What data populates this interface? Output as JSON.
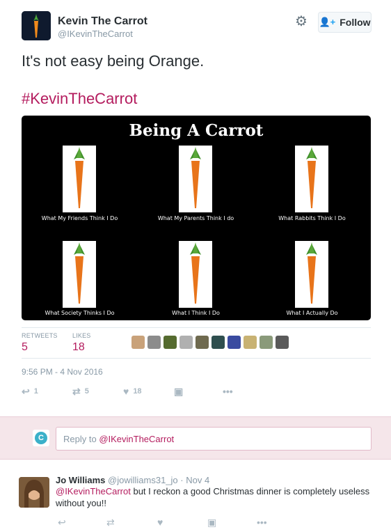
{
  "author": {
    "name": "Kevin The Carrot",
    "handle": "@IKevinTheCarrot"
  },
  "follow_label": "Follow",
  "tweet": {
    "text": "It's not easy being Orange.",
    "hashtag": "#KevinTheCarrot"
  },
  "media": {
    "title": "Being A Carrot",
    "captions": [
      "What My Friends Think I Do",
      "What My Parents Think I do",
      "What Rabbits Think I Do",
      "What Society Thinks I Do",
      "What I Think I Do",
      "What I Actually Do"
    ]
  },
  "stats": {
    "retweets_label": "RETWEETS",
    "retweets": "5",
    "likes_label": "LIKES",
    "likes": "18"
  },
  "likers_colors": [
    "#c9a27a",
    "#8c8c8c",
    "#556b2f",
    "#b0b0b0",
    "#6f6a4f",
    "#2f4f4f",
    "#3a4ba0",
    "#c8b273",
    "#8a9a7a",
    "#5a5a5a"
  ],
  "timestamp": "9:56 PM - 4 Nov 2016",
  "actions": {
    "reply_count": "1",
    "retweet_count": "5",
    "like_count": "18"
  },
  "reply_box": {
    "prefix": "Reply to ",
    "mention": "@IKevinTheCarrot"
  },
  "reply": {
    "name": "Jo Williams",
    "handle": "@jowilliams31_jo",
    "dot": "·",
    "date": "Nov 4",
    "mention": "@IKevinTheCarrot",
    "text": " but I reckon a good Christmas dinner is completely useless without you!!"
  },
  "colors": {
    "accent": "#b41c5e",
    "follow_icon": "#1da1f2",
    "muted": "#8899a6",
    "reply_bg": "#f5e6ea"
  }
}
